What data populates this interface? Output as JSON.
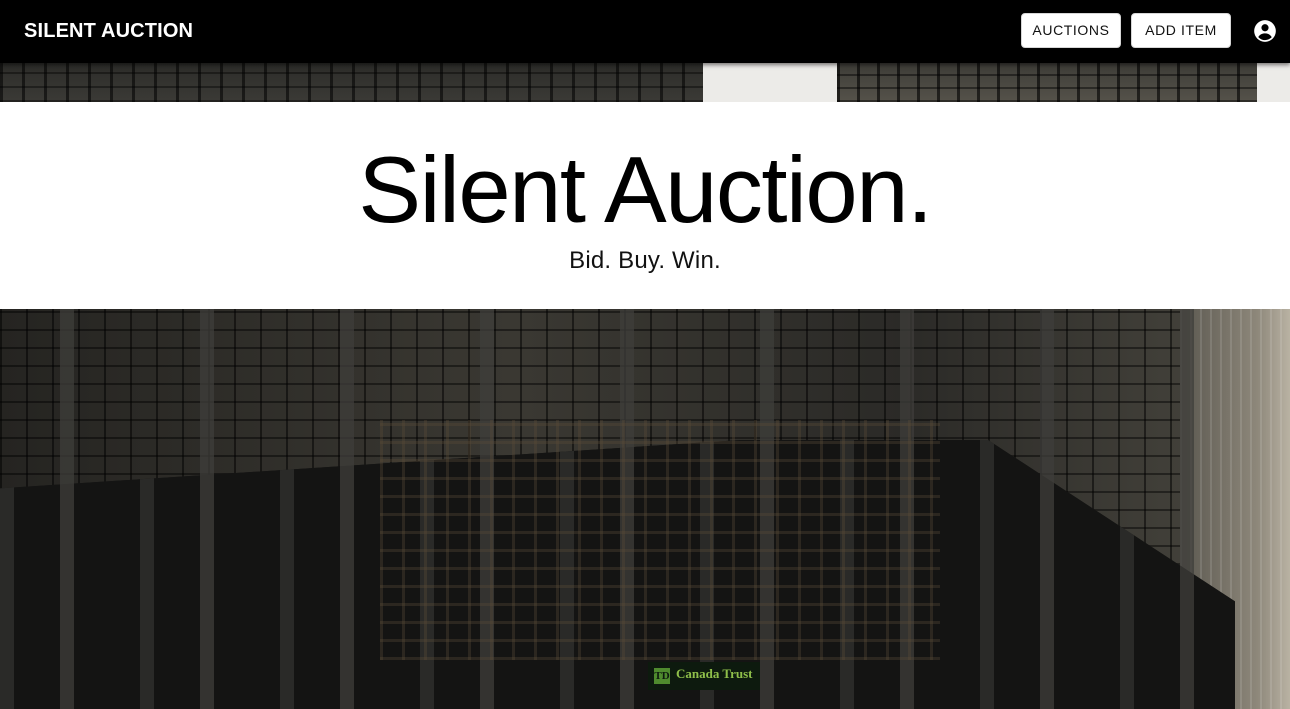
{
  "appbar": {
    "brand": "SILENT AUCTION",
    "nav": [
      {
        "label": "AUCTIONS"
      },
      {
        "label": "ADD ITEM"
      }
    ],
    "account_icon": "account-circle-icon"
  },
  "hero": {
    "title": "Silent Auction.",
    "subtitle": "Bid. Buy. Win."
  },
  "background": {
    "sign_mark": "TD",
    "sign_text": "Canada Trust"
  },
  "colors": {
    "appbar": "#000000",
    "hero_band": "#ffffff",
    "button_bg": "#ffffff",
    "sign_green": "#8fbf4a"
  }
}
